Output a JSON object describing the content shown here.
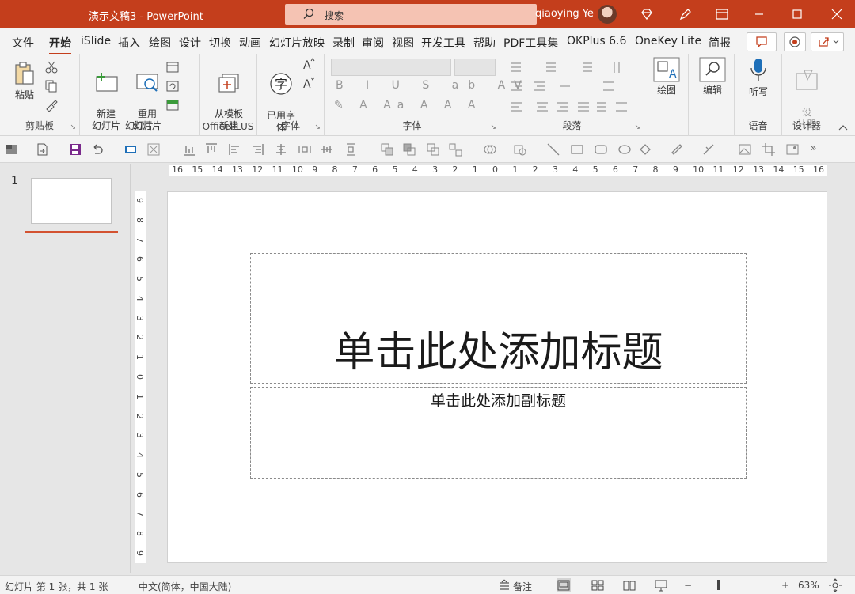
{
  "titlebar": {
    "doc_title": "演示文稿3  -  PowerPoint",
    "search_label": "搜索",
    "user_name": "qiaoying Ye"
  },
  "menu": {
    "tabs": [
      "文件",
      "开始",
      "iSlide",
      "插入",
      "绘图",
      "设计",
      "切换",
      "动画",
      "幻灯片放映",
      "录制",
      "审阅",
      "视图",
      "开发工具",
      "帮助",
      "PDF工具集",
      "OKPlus 6.6",
      "OneKey Lite",
      "简报"
    ],
    "active_tab": "开始"
  },
  "ribbon": {
    "clipboard": {
      "paste": "粘贴",
      "label": "剪贴板"
    },
    "slides": {
      "new_slide": "新建\n幻灯片",
      "reuse_slide": "重用\n幻灯片",
      "label": "幻灯片"
    },
    "officeplus": {
      "from_template": "从模板\n新建",
      "label": "OfficePLUS"
    },
    "font_preset": {
      "common_font": "已用字\n体",
      "label": "字体"
    },
    "font": {
      "label": "字体"
    },
    "paragraph": {
      "label": "段落"
    },
    "drawing": {
      "draw": "绘图"
    },
    "editing": {
      "edit": "编辑"
    },
    "voice": {
      "dictate": "听写",
      "label": "语音"
    },
    "designer": {
      "design": "设\n计器",
      "label": "设计器"
    }
  },
  "slide_panel": {
    "slide_number": "1"
  },
  "ruler": {
    "h_ticks": [
      "16",
      "15",
      "14",
      "13",
      "12",
      "11",
      "10",
      "9",
      "8",
      "7",
      "6",
      "5",
      "4",
      "3",
      "2",
      "1",
      "0",
      "1",
      "2",
      "3",
      "4",
      "5",
      "6",
      "7",
      "8",
      "9",
      "10",
      "11",
      "12",
      "13",
      "14",
      "15",
      "16"
    ],
    "v_ticks": [
      "9",
      "8",
      "7",
      "6",
      "5",
      "4",
      "3",
      "2",
      "1",
      "0",
      "1",
      "2",
      "3",
      "4",
      "5",
      "6",
      "7",
      "8",
      "9"
    ]
  },
  "slide": {
    "title_placeholder": "单击此处添加标题",
    "subtitle_placeholder": "单击此处添加副标题"
  },
  "statusbar": {
    "slide_count": "幻灯片 第 1 张，共 1 张",
    "language": "中文(简体，中国大陆)",
    "notes": "备注",
    "zoom_percent": "63%"
  },
  "colors": {
    "accent": "#c43e1c",
    "underline": "#d35230"
  }
}
